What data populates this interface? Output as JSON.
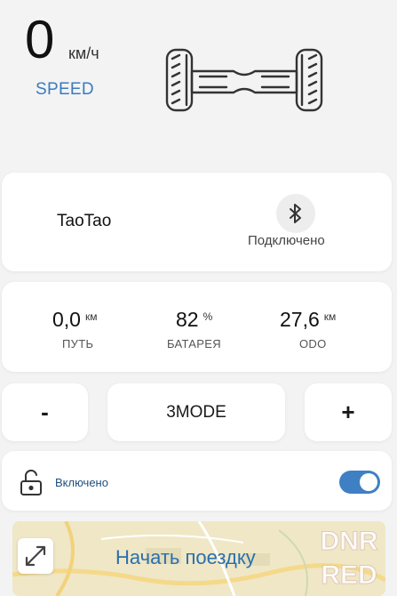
{
  "speed": {
    "value": "0",
    "unit": "км/ч",
    "label": "SPEED"
  },
  "device": {
    "name": "TaoTao",
    "status": "Подключено"
  },
  "stats": [
    {
      "value": "0,0",
      "unit": "км",
      "label": "ПУТЬ"
    },
    {
      "value": "82",
      "unit": "%",
      "label": "БАТАРЕЯ"
    },
    {
      "value": "27,6",
      "unit": "км",
      "label": "ODO"
    }
  ],
  "controls": {
    "minus": "-",
    "mode": "3MODE",
    "plus": "+"
  },
  "lock": {
    "label": "Включено",
    "toggle_on": true
  },
  "map": {
    "start_label": "Начать поездку"
  },
  "watermark": {
    "line1": "DNR",
    "line2": "RED"
  },
  "colors": {
    "accent": "#3f80c4",
    "background": "#f3f3f3",
    "map": "#efe7c6"
  },
  "icons": [
    "hoverboard-icon",
    "bluetooth-icon",
    "unlock-icon",
    "expand-icon"
  ]
}
